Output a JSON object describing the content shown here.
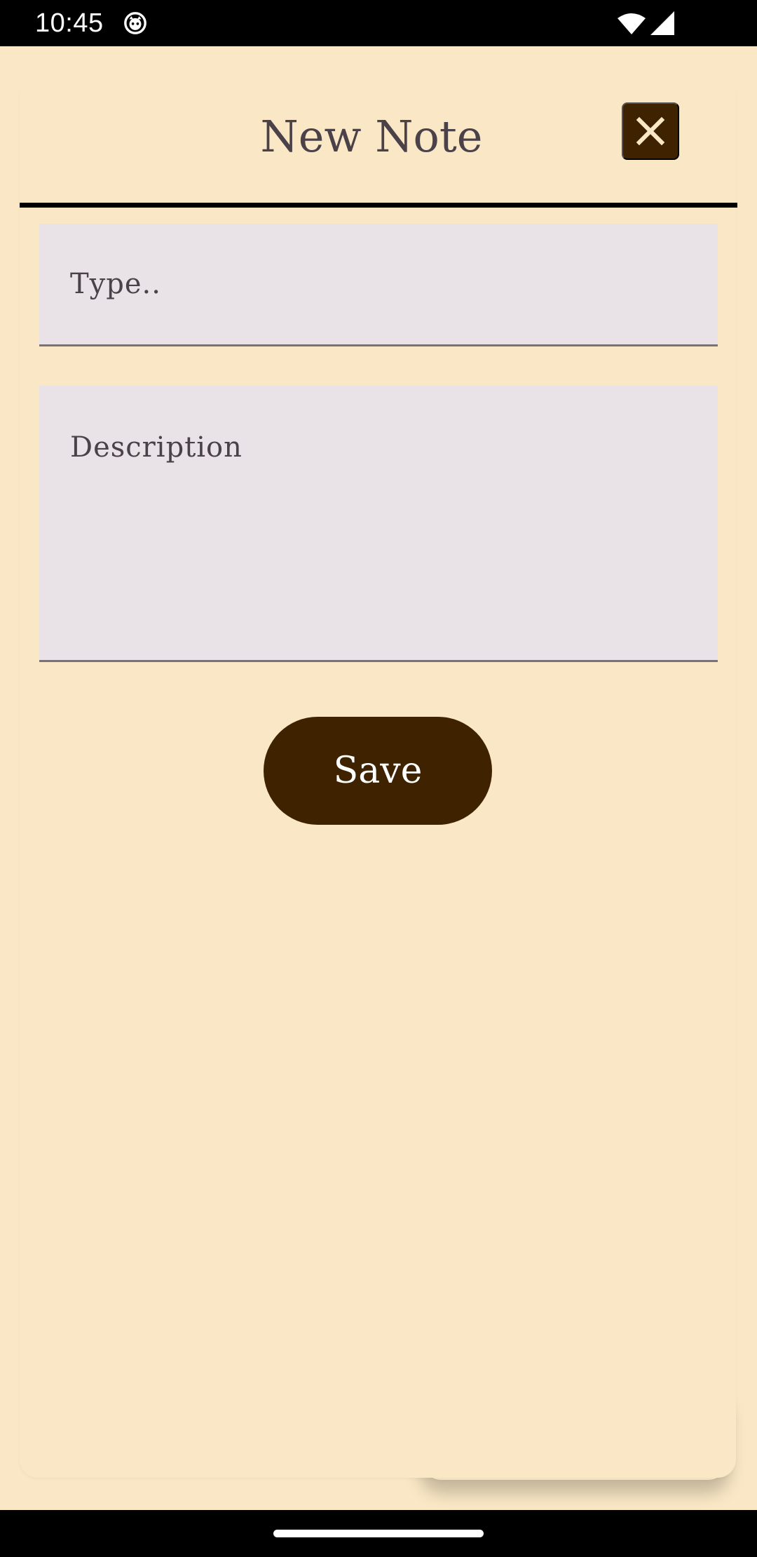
{
  "status_bar": {
    "time": "10:45",
    "icons": [
      "cat-face-icon",
      "wifi-icon",
      "cellular-signal-icon"
    ]
  },
  "dialog": {
    "title": "New Note",
    "close_icon": "close-icon",
    "type_field": {
      "value": "",
      "placeholder": "Type.."
    },
    "description_field": {
      "value": "",
      "placeholder": "Description"
    },
    "save_label": "Save"
  },
  "colors": {
    "background": "#f9e7c5",
    "accent": "#3f2200",
    "field_background": "#e9e2e6",
    "text": "#4b4249"
  }
}
